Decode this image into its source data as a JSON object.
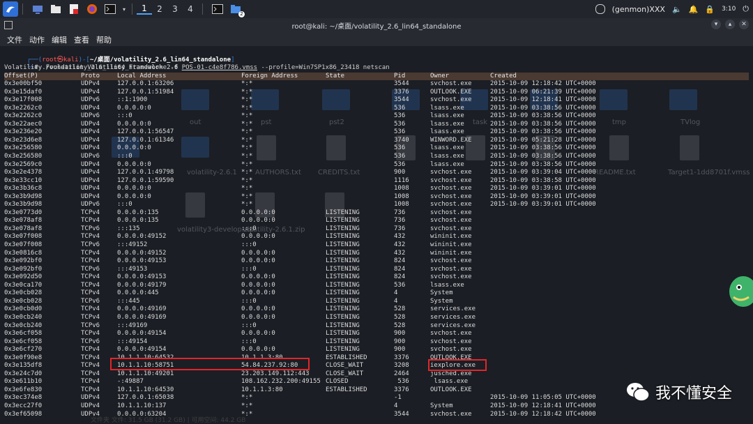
{
  "topbar": {
    "workspaces": [
      "1",
      "2",
      "3",
      "4"
    ],
    "badge": "2",
    "genmon": "(genmon)XXX",
    "clock": "3:10"
  },
  "window": {
    "title": "root@kali: ~/桌面/volatility_2.6_lin64_standalone"
  },
  "menu": [
    "文件",
    "动作",
    "编辑",
    "查看",
    "帮助"
  ],
  "prompt": {
    "user": "root㉿kali",
    "path": "~/桌面/volatility_2.6_lin64_standalone",
    "cmd_prefix": "# ./volatility_2.6_lin64_standalone -f ",
    "image_file": "POS-01-c4e8f786.vmss",
    "cmd_suffix": " --profile=Win7SP1x86_23418 netscan",
    "banner": "Volatility Foundation Volatility Framework 2.6"
  },
  "table": {
    "headers": [
      "Offset(P)",
      "Proto",
      "Local Address",
      "Foreign Address",
      "State",
      "Pid",
      "Owner",
      "Created"
    ],
    "rows": [
      [
        "0x3e00bf50",
        "UDPv4",
        "127.0.0.1:63206",
        "*:*",
        "",
        "3544",
        "svchost.exe",
        "2015-10-09 12:18:42 UTC+0000"
      ],
      [
        "0x3e15daf0",
        "UDPv4",
        "127.0.0.1:51984",
        "*:*",
        "",
        "3376",
        "OUTLOOK.EXE",
        "2015-10-09 06:21:39 UTC+0000"
      ],
      [
        "0x3e17f008",
        "UDPv6",
        "::1:1900",
        "*:*",
        "",
        "3544",
        "svchost.exe",
        "2015-10-09 12:18:41 UTC+0000"
      ],
      [
        "0x3e2262c0",
        "UDPv4",
        "0.0.0.0:0",
        "*:*",
        "",
        "536",
        "lsass.exe",
        "2015-10-09 03:38:56 UTC+0000"
      ],
      [
        "0x3e2262c0",
        "UDPv6",
        ":::0",
        "*:*",
        "",
        "536",
        "lsass.exe",
        "2015-10-09 03:38:56 UTC+0000"
      ],
      [
        "0x3e22aec0",
        "UDPv4",
        "0.0.0.0:0",
        "*:*",
        "",
        "536",
        "lsass.exe",
        "2015-10-09 03:38:56 UTC+0000"
      ],
      [
        "0x3e236e20",
        "UDPv4",
        "127.0.0.1:56547",
        "*:*",
        "",
        "536",
        "lsass.exe",
        "2015-10-09 03:38:56 UTC+0000"
      ],
      [
        "0x3e23d6e8",
        "UDPv4",
        "127.0.0.1:61346",
        "*:*",
        "",
        "3740",
        "WINWORD.EXE",
        "2015-10-09 05:21:28 UTC+0000"
      ],
      [
        "0x3e256580",
        "UDPv4",
        "0.0.0.0:0",
        "*:*",
        "",
        "536",
        "lsass.exe",
        "2015-10-09 03:38:56 UTC+0000"
      ],
      [
        "0x3e256580",
        "UDPv6",
        ":::0",
        "*:*",
        "",
        "536",
        "lsass.exe",
        "2015-10-09 03:38:56 UTC+0000"
      ],
      [
        "0x3e2569c0",
        "UDPv4",
        "0.0.0.0:0",
        "*:*",
        "",
        "536",
        "lsass.exe",
        "2015-10-09 03:38:56 UTC+0000"
      ],
      [
        "0x3e2e4378",
        "UDPv4",
        "127.0.0.1:49798",
        "*:*",
        "",
        "900",
        "svchost.exe",
        "2015-10-09 03:39:04 UTC+0000"
      ],
      [
        "0x3e33cc10",
        "UDPv4",
        "127.0.0.1:59590",
        "*:*",
        "",
        "1116",
        "svchost.exe",
        "2015-10-09 03:38:58 UTC+0000"
      ],
      [
        "0x3e3b36c8",
        "UDPv4",
        "0.0.0.0:0",
        "*:*",
        "",
        "1008",
        "svchost.exe",
        "2015-10-09 03:39:01 UTC+0000"
      ],
      [
        "0x3e3b9d98",
        "UDPv4",
        "0.0.0.0:0",
        "*:*",
        "",
        "1008",
        "svchost.exe",
        "2015-10-09 03:39:01 UTC+0000"
      ],
      [
        "0x3e3b9d98",
        "UDPv6",
        ":::0",
        "*:*",
        "",
        "1008",
        "svchost.exe",
        "2015-10-09 03:39:01 UTC+0000"
      ],
      [
        "0x3e0773d0",
        "TCPv4",
        "0.0.0.0:135",
        "0.0.0.0:0",
        "LISTENING",
        "736",
        "svchost.exe",
        ""
      ],
      [
        "0x3e078af8",
        "TCPv4",
        "0.0.0.0:135",
        "0.0.0.0:0",
        "LISTENING",
        "736",
        "svchost.exe",
        ""
      ],
      [
        "0x3e078af8",
        "TCPv6",
        ":::135",
        ":::0",
        "LISTENING",
        "736",
        "svchost.exe",
        ""
      ],
      [
        "0x3e07f008",
        "TCPv4",
        "0.0.0.0:49152",
        "0.0.0.0:0",
        "LISTENING",
        "432",
        "wininit.exe",
        ""
      ],
      [
        "0x3e07f008",
        "TCPv6",
        ":::49152",
        ":::0",
        "LISTENING",
        "432",
        "wininit.exe",
        ""
      ],
      [
        "0x3e0816c8",
        "TCPv4",
        "0.0.0.0:49152",
        "0.0.0.0:0",
        "LISTENING",
        "432",
        "wininit.exe",
        ""
      ],
      [
        "0x3e092bf0",
        "TCPv4",
        "0.0.0.0:49153",
        "0.0.0.0:0",
        "LISTENING",
        "824",
        "svchost.exe",
        ""
      ],
      [
        "0x3e092bf0",
        "TCPv6",
        ":::49153",
        ":::0",
        "LISTENING",
        "824",
        "svchost.exe",
        ""
      ],
      [
        "0x3e092d50",
        "TCPv4",
        "0.0.0.0:49153",
        "0.0.0.0:0",
        "LISTENING",
        "824",
        "svchost.exe",
        ""
      ],
      [
        "0x3e0ca170",
        "TCPv4",
        "0.0.0.0:49179",
        "0.0.0.0:0",
        "LISTENING",
        "536",
        "lsass.exe",
        ""
      ],
      [
        "0x3e0cb028",
        "TCPv4",
        "0.0.0.0:445",
        "0.0.0.0:0",
        "LISTENING",
        "4",
        "System",
        ""
      ],
      [
        "0x3e0cb028",
        "TCPv6",
        ":::445",
        ":::0",
        "LISTENING",
        "4",
        "System",
        ""
      ],
      [
        "0x3e0cb0d0",
        "TCPv4",
        "0.0.0.0:49169",
        "0.0.0.0:0",
        "LISTENING",
        "528",
        "services.exe",
        ""
      ],
      [
        "0x3e0cb240",
        "TCPv4",
        "0.0.0.0:49169",
        "0.0.0.0:0",
        "LISTENING",
        "528",
        "services.exe",
        ""
      ],
      [
        "0x3e0cb240",
        "TCPv6",
        ":::49169",
        ":::0",
        "LISTENING",
        "528",
        "services.exe",
        ""
      ],
      [
        "0x3e6cf058",
        "TCPv4",
        "0.0.0.0:49154",
        "0.0.0.0:0",
        "LISTENING",
        "900",
        "svchost.exe",
        ""
      ],
      [
        "0x3e6cf058",
        "TCPv6",
        ":::49154",
        ":::0",
        "LISTENING",
        "900",
        "svchost.exe",
        ""
      ],
      [
        "0x3e6cf270",
        "TCPv4",
        "0.0.0.0:49154",
        "0.0.0.0:0",
        "LISTENING",
        "900",
        "svchost.exe",
        ""
      ],
      [
        "0x3e0f90e8",
        "TCPv4",
        "10.1.1.10:64532",
        "10.1.1.3:80",
        "ESTABLISHED",
        "3376",
        "OUTLOOK.EXE",
        ""
      ],
      [
        "0x3e135df8",
        "TCPv4",
        "10.1.1.10:58751",
        "54.84.237.92:80",
        "CLOSE_WAIT",
        "3208",
        "iexplore.exe",
        ""
      ],
      [
        "0x3e24c7d0",
        "TCPv4",
        "10.1.1.10:49201",
        "23.203.149.112:443",
        "CLOSE_WAIT",
        "2464",
        "jusched.exe",
        ""
      ],
      [
        "0x3e611b10",
        "TCPv4",
        "-:49887",
        "108.162.232.200:49155",
        "CLOSED",
        " 536",
        " lsass.exe",
        ""
      ],
      [
        "0x3e6fe830",
        "TCPv4",
        "10.1.1.10:64530",
        "10.1.1.3:80",
        "ESTABLISHED",
        "3376",
        "OUTLOOK.EXE",
        ""
      ],
      [
        "0x3ec374e8",
        "UDPv4",
        "127.0.0.1:65038",
        "*:*",
        "",
        "-1",
        "",
        "2015-10-09 11:05:05 UTC+0000"
      ],
      [
        "0x3ecc27f0",
        "UDPv4",
        "10.1.1.10:137",
        "*:*",
        "",
        "4",
        "System",
        "2015-10-09 12:18:41 UTC+0000"
      ],
      [
        "0x3ef65098",
        "UDPv4",
        "0.0.0.0:63204",
        "*:*",
        "",
        "3544",
        "svchost.exe",
        "2015-10-09 12:18:42 UTC+0000"
      ]
    ]
  },
  "desktop_labels": [
    "out",
    "pst",
    "pst2",
    "task",
    "tmp",
    "TVlog",
    "volatility-2.6.1",
    "CREDITS.txt",
    "AUTHORS.txt",
    "README.txt",
    "Target1-1dd8701f.vmss",
    "volatility3-develop.zip",
    "volatility-2.6.1.zip"
  ],
  "watermark": "我不懂安全",
  "status_strip": "文件夹 文件: 31.5 GB (31.2 GB) | 可用空间: 44.2 GB"
}
